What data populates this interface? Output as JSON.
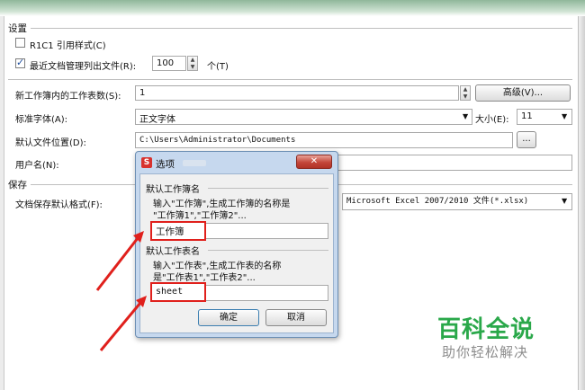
{
  "settings_section": {
    "title": "设置",
    "r1c1_label": "R1C1 引用样式(C)",
    "r1c1_checked": false,
    "recent_label": "最近文档管理列出文件(R):",
    "recent_checked": true,
    "recent_value": "100",
    "recent_unit": "个(T)"
  },
  "workbook": {
    "sheets_label": "新工作簿内的工作表数(S):",
    "sheets_value": "1",
    "advanced_button": "高级(V)...",
    "font_label": "标准字体(A):",
    "font_value": "正文字体",
    "size_label": "大小(E):",
    "size_value": "11",
    "location_label": "默认文件位置(D):",
    "location_value": "C:\\Users\\Administrator\\Documents",
    "browse_button": "...",
    "username_label": "用户名(N):"
  },
  "save_section": {
    "title": "保存",
    "format_label": "文档保存默认格式(F):",
    "format_value": "Microsoft Excel 2007/2010 文件(*.xlsx)"
  },
  "dialog": {
    "title": "选项",
    "close_symbol": "✕",
    "wb_group_title": "默认工作簿名",
    "wb_desc_line1": "输入\"工作簿\",生成工作簿的名称是",
    "wb_desc_line2": "\"工作簿1\",\"工作簿2\"...",
    "wb_input_value": "工作簿",
    "ws_group_title": "默认工作表名",
    "ws_desc_line1": "输入\"工作表\",生成工作表的名称",
    "ws_desc_line2": "是\"工作表1\",\"工作表2\"...",
    "ws_input_value": "sheet",
    "ok_button": "确定",
    "cancel_button": "取消"
  },
  "watermark": {
    "main": "百科全说",
    "sub": "助你轻松解决"
  },
  "colors": {
    "annotation_red": "#e0201c",
    "watermark_green": "#2aa84a"
  }
}
